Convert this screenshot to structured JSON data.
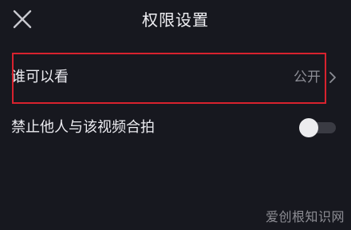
{
  "header": {
    "title": "权限设置",
    "close_icon": "close-icon"
  },
  "settings": {
    "who_can_view": {
      "label": "谁可以看",
      "value": "公开",
      "icon": "chevron-right-icon"
    },
    "disable_duet": {
      "label": "禁止他人与该视频合拍",
      "toggle_on": false
    }
  },
  "annotation": {
    "highlight_color": "#d8222e"
  },
  "watermark": {
    "text": "爱创根知识网"
  },
  "colors": {
    "background": "#17181f",
    "secondary_text": "#8d8e96"
  }
}
